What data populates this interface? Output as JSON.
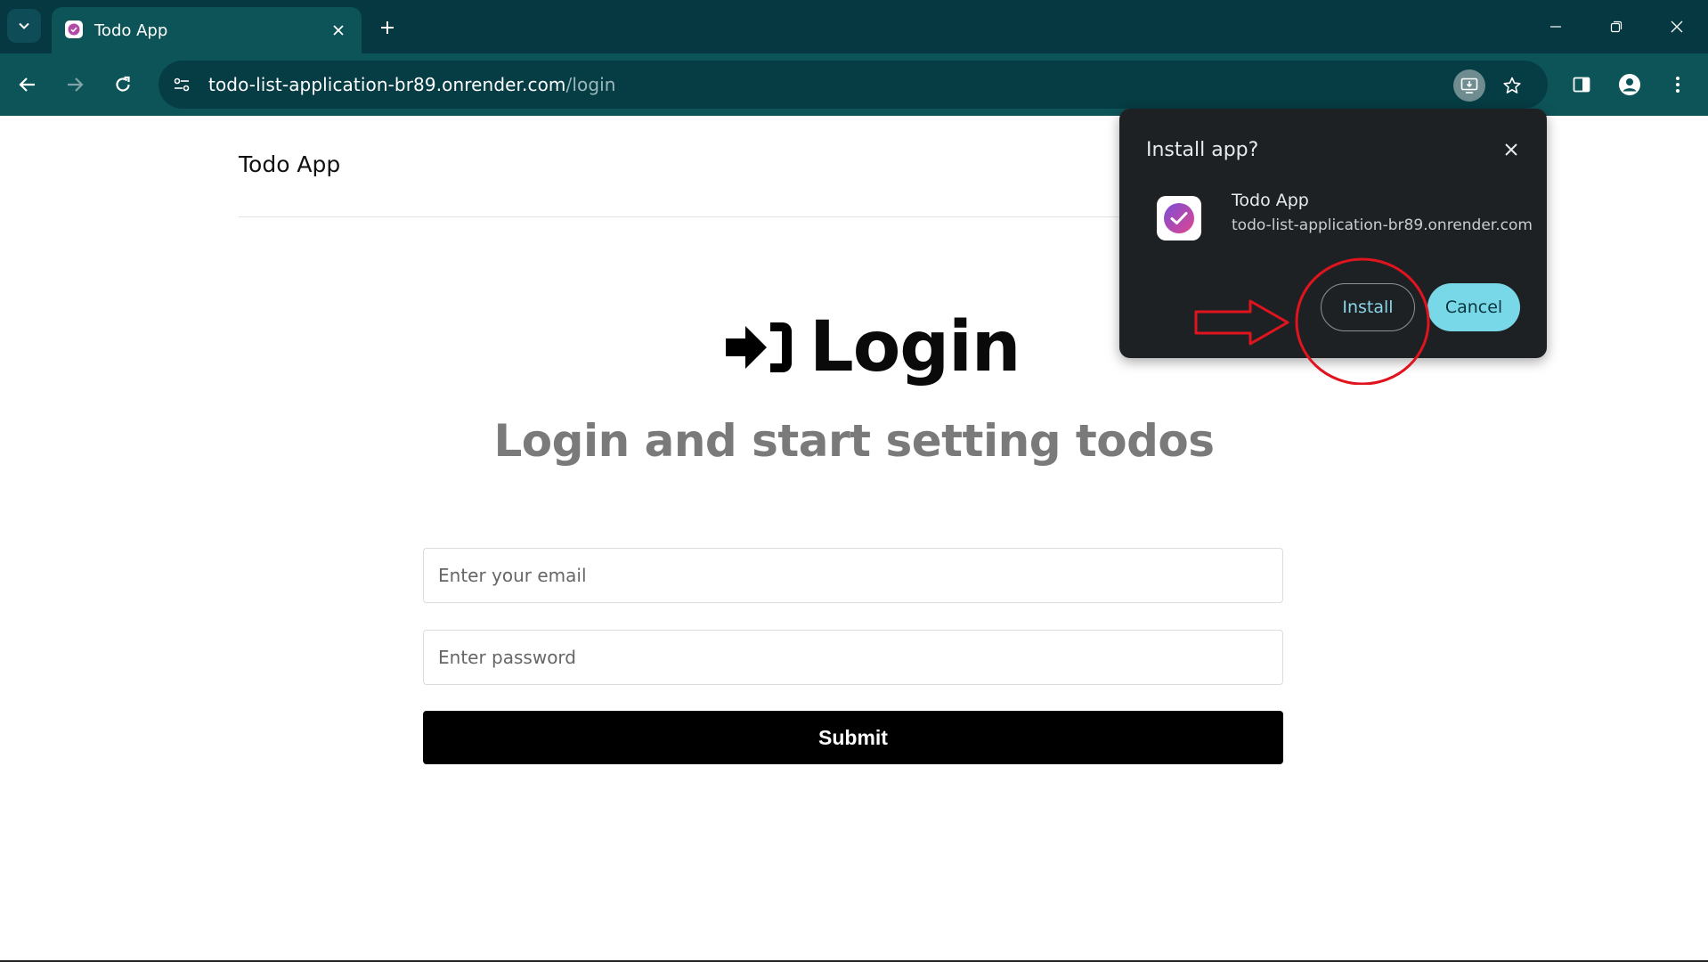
{
  "browser": {
    "tab": {
      "title": "Todo App"
    },
    "address_bar": {
      "host": "todo-list-application-br89.onrender.com",
      "path": "/login"
    },
    "icons": {
      "tab_search": "chevron-down-icon",
      "tab_close": "close-icon",
      "new_tab": "plus-icon",
      "minimize": "minimize-icon",
      "restore": "restore-icon",
      "window_close": "close-icon",
      "back": "arrow-left-icon",
      "forward": "arrow-right-icon",
      "reload": "reload-icon",
      "site_info": "tune-icon",
      "install": "install-app-icon",
      "bookmark": "star-icon",
      "side_panel": "side-panel-icon",
      "profile": "profile-icon",
      "menu": "more-vert-icon"
    }
  },
  "page": {
    "brand": "Todo App",
    "heading": "Login",
    "subtitle": "Login and start setting todos",
    "email_placeholder": "Enter your email",
    "password_placeholder": "Enter password",
    "submit_label": "Submit"
  },
  "install_dialog": {
    "title": "Install app?",
    "app_name": "Todo App",
    "app_url": "todo-list-application-br89.onrender.com",
    "install_label": "Install",
    "cancel_label": "Cancel"
  },
  "colors": {
    "tabstrip": "#053841",
    "toolbar": "#0d5459",
    "dialog_bg": "#1e2124",
    "cancel_button": "#79d8e8",
    "annotation": "#e0141e"
  }
}
